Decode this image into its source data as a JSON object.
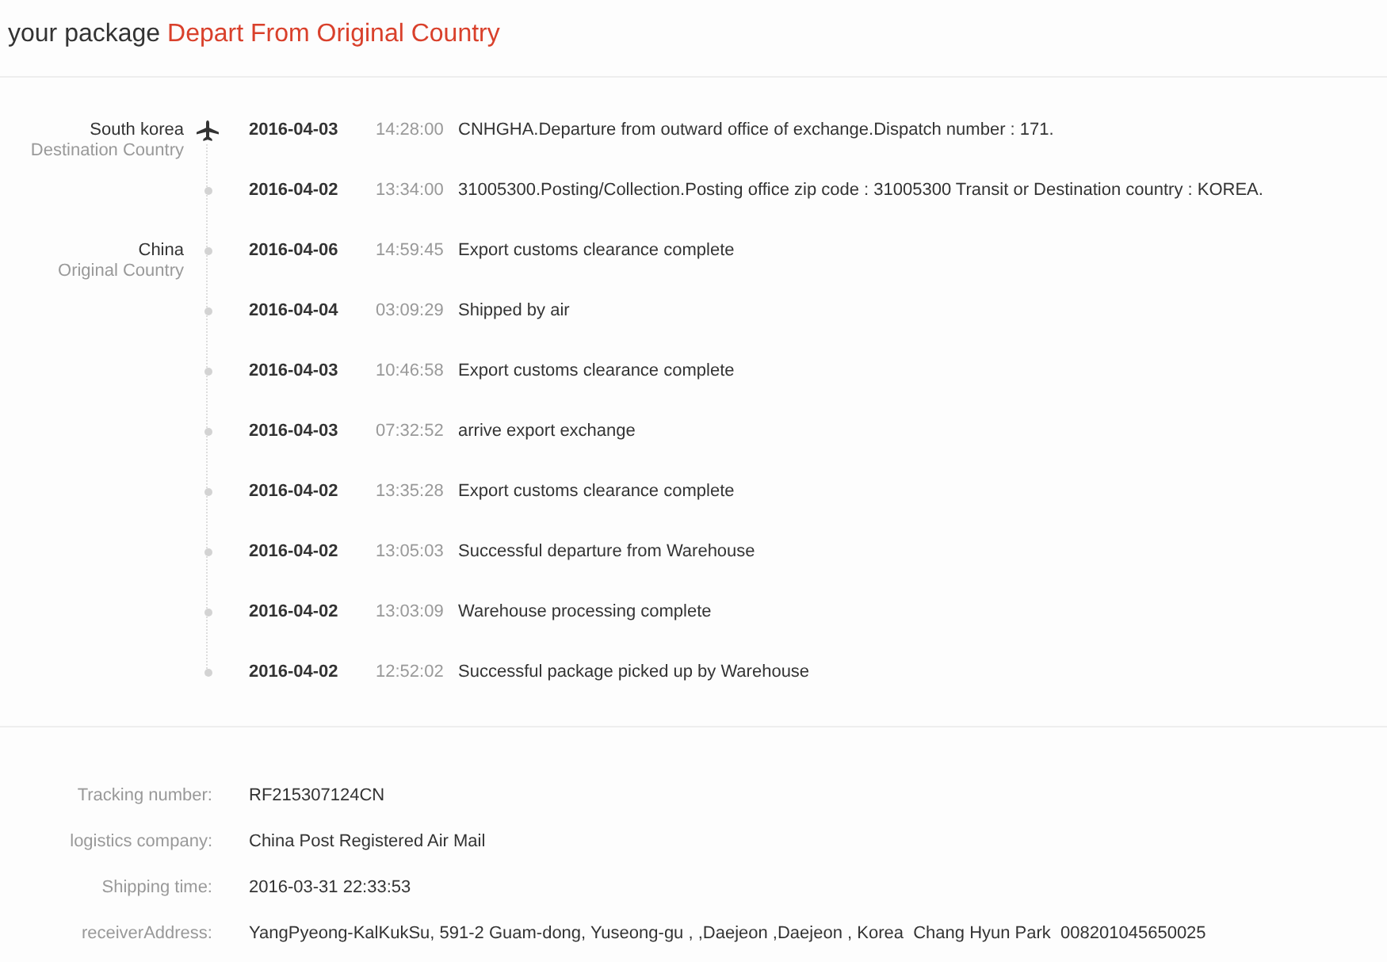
{
  "header": {
    "prefix": "your package",
    "status": "Depart From Original Country"
  },
  "timeline": [
    {
      "kind": "plane",
      "location": "South korea",
      "location_role": "Destination Country",
      "date": "2016-04-03",
      "time": "14:28:00",
      "description": "CNHGHA.Departure from outward office of exchange.Dispatch number : 171."
    },
    {
      "kind": "dot",
      "date": "2016-04-02",
      "time": "13:34:00",
      "description": "31005300.Posting/Collection.Posting office zip code : 31005300 Transit or Destination country : KOREA."
    },
    {
      "kind": "dot",
      "location": "China",
      "location_role": "Original Country",
      "date": "2016-04-06",
      "time": "14:59:45",
      "description": "Export customs clearance complete"
    },
    {
      "kind": "dot",
      "date": "2016-04-04",
      "time": "03:09:29",
      "description": "Shipped by air"
    },
    {
      "kind": "dot",
      "date": "2016-04-03",
      "time": "10:46:58",
      "description": "Export customs clearance complete"
    },
    {
      "kind": "dot",
      "date": "2016-04-03",
      "time": "07:32:52",
      "description": "arrive export exchange"
    },
    {
      "kind": "dot",
      "date": "2016-04-02",
      "time": "13:35:28",
      "description": "Export customs clearance complete"
    },
    {
      "kind": "dot",
      "date": "2016-04-02",
      "time": "13:05:03",
      "description": "Successful departure from Warehouse"
    },
    {
      "kind": "dot",
      "date": "2016-04-02",
      "time": "13:03:09",
      "description": "Warehouse processing complete"
    },
    {
      "kind": "dot",
      "date": "2016-04-02",
      "time": "12:52:02",
      "description": "Successful package picked up by Warehouse"
    }
  ],
  "details": [
    {
      "label": "Tracking number:",
      "value": "RF215307124CN"
    },
    {
      "label": "logistics company:",
      "value": "China Post Registered Air Mail"
    },
    {
      "label": "Shipping time:",
      "value": "2016-03-31 22:33:53"
    },
    {
      "label": "receiverAddress:",
      "value": "YangPyeong-KalKukSu, 591-2 Guam-dong, Yuseong-gu , ,Daejeon ,Daejeon , Korea  Chang Hyun Park  008201045650025"
    }
  ]
}
